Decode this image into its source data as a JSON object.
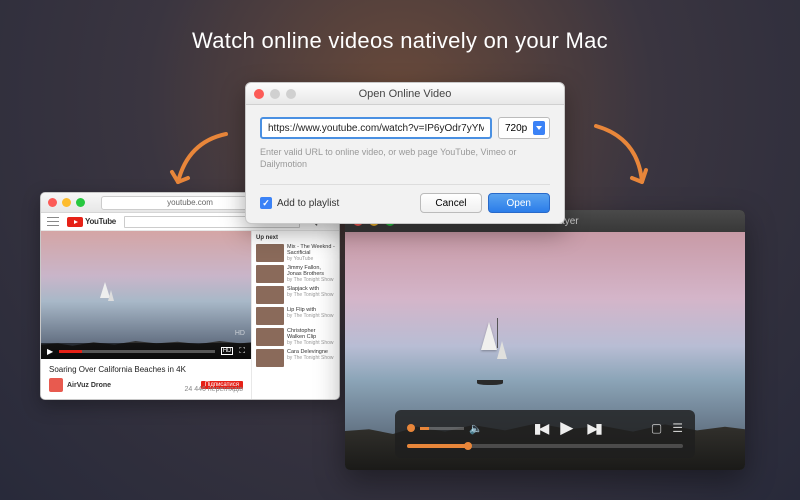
{
  "headline": "Watch online videos natively on your Mac",
  "dialog": {
    "title": "Open Online Video",
    "url": "https://www.youtube.com/watch?v=IP6yOdr7yYM",
    "quality": "720p",
    "hint": "Enter valid URL to online video, or web page YouTube, Vimeo or Dailymotion",
    "add_to_playlist": "Add to playlist",
    "cancel": "Cancel",
    "open": "Open"
  },
  "browser": {
    "address": "youtube.com",
    "yt_brand": "YouTube",
    "up_next": "Up next",
    "video_title": "Soaring Over California Beaches in 4K",
    "channel": "AirVuz Drone",
    "subscribe": "Підписатися",
    "views": "24 446 переглядів",
    "recommendations": [
      {
        "title": "Mix - The Weeknd - Sacrificial",
        "by": "by YouTube"
      },
      {
        "title": "Jimmy Fallon, Jonas Brothers",
        "by": "by The Tonight Show"
      },
      {
        "title": "Slapjack with",
        "by": "by The Tonight Show"
      },
      {
        "title": "Lip Flip with",
        "by": "by The Tonight Show"
      },
      {
        "title": "Christopher Walken Clip",
        "by": "by The Tonight Show"
      },
      {
        "title": "Cara Delevingne",
        "by": "by The Tonight Show"
      }
    ]
  },
  "player": {
    "title": "Elmedia Player"
  },
  "colors": {
    "accent_orange": "#e8863a",
    "youtube_red": "#e62117",
    "mac_blue": "#3b82f6"
  }
}
